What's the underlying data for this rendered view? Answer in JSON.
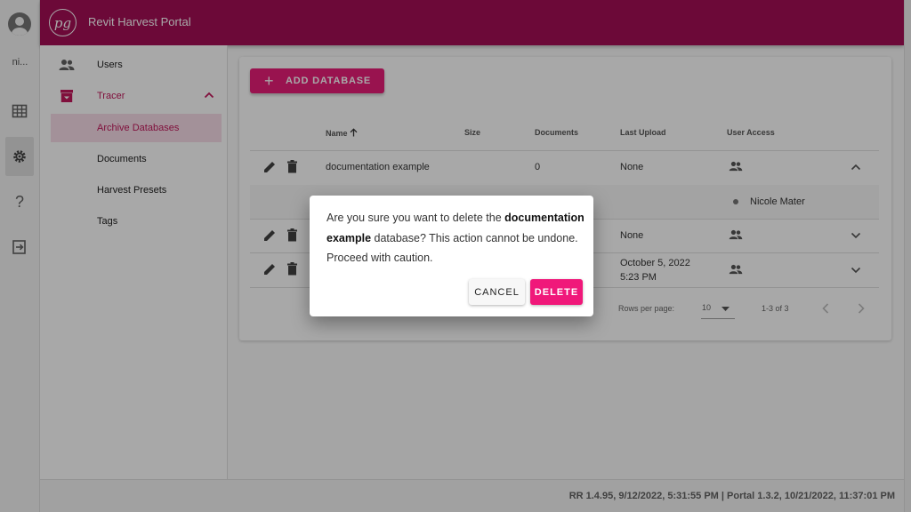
{
  "app": {
    "title": "Revit Harvest Portal",
    "logo_text": "pg",
    "accent": "#a50f55",
    "button_pink": "#e91e78"
  },
  "rail": {
    "username": "ni...",
    "icons": [
      "account-icon",
      "grid-icon",
      "gear-icon",
      "help-icon",
      "logout-icon"
    ]
  },
  "nav": {
    "users": "Users",
    "tracer": "Tracer",
    "items": [
      "Archive Databases",
      "Documents",
      "Harvest Presets",
      "Tags"
    ]
  },
  "toolbar": {
    "add_label": "ADD DATABASE"
  },
  "table": {
    "headers": {
      "name": "Name",
      "size": "Size",
      "documents": "Documents",
      "last_upload": "Last Upload",
      "user_access": "User Access"
    },
    "rows": [
      {
        "name": "documentation example",
        "size": "",
        "documents": "0",
        "last_upload": "None",
        "expanded": true
      },
      {
        "name": "",
        "size": "",
        "documents": "",
        "last_upload": "None",
        "expanded": false
      },
      {
        "name": "",
        "size": "",
        "documents": "",
        "last_upload_line1": "October 5, 2022",
        "last_upload_line2": "5:23 PM",
        "expanded": false
      }
    ],
    "access_user": "Nicole Mater",
    "footer": {
      "rows_per_page_label": "Rows per page:",
      "rows_per_page": "10",
      "range": "1-3 of 3"
    }
  },
  "dialog": {
    "msg_before": "Are you sure you want to delete the",
    "msg_bold": "documentation example",
    "msg_after": " database? This action cannot be undone. Proceed with caution.",
    "cancel": "CANCEL",
    "delete": "DELETE"
  },
  "status": {
    "version_text": "RR 1.4.95, 9/12/2022, 5:31:55 PM | Portal 1.3.2, 10/21/2022, 11:37:01 PM"
  }
}
